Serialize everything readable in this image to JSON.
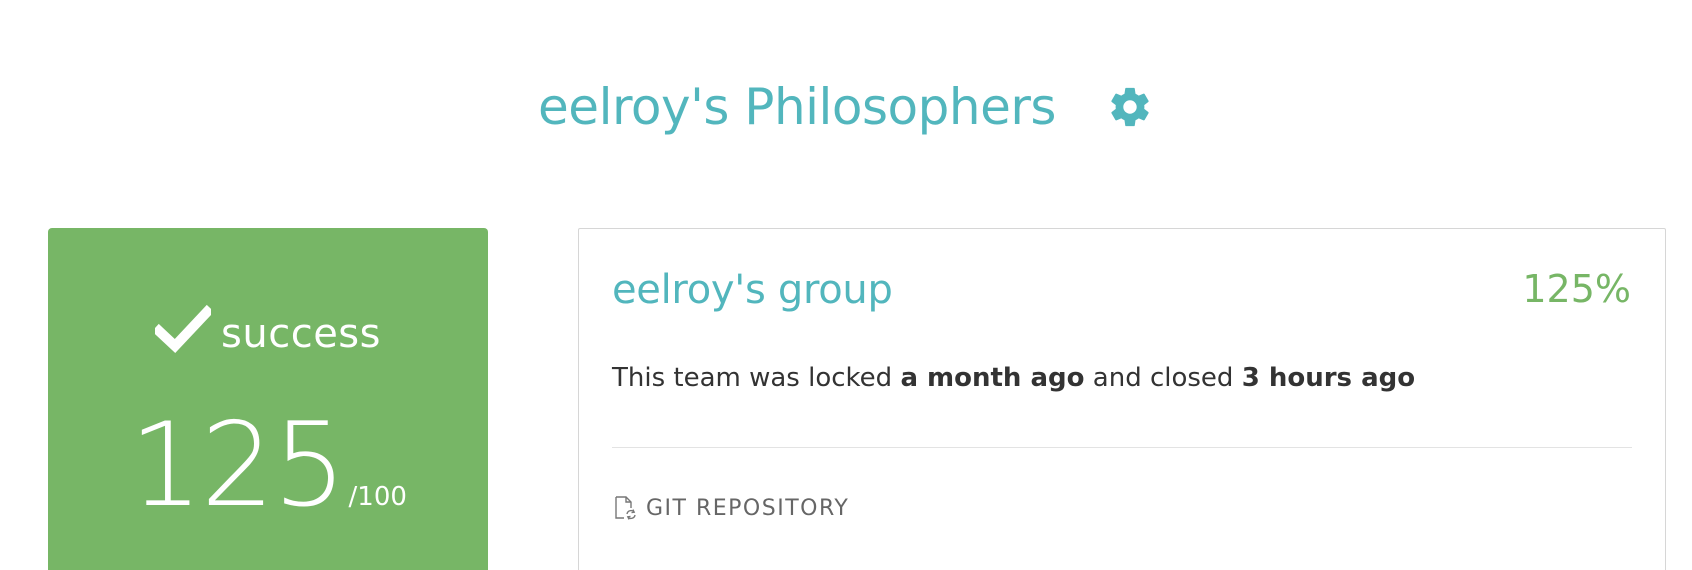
{
  "header": {
    "team_title": "eelroy's Philosophers",
    "settings_icon": "gear-icon"
  },
  "status": {
    "icon": "check-icon",
    "label": "success",
    "score": "125",
    "score_max": "/100",
    "color": "#77b666"
  },
  "group": {
    "name": "eelroy's group",
    "percent": "125%",
    "lock_prefix": "This team was locked ",
    "locked_when": "a month ago",
    "lock_middle": " and closed ",
    "closed_when": "3 hours ago",
    "repo_icon": "file-refresh-icon",
    "repo_label": "GIT REPOSITORY"
  },
  "colors": {
    "accent": "#52b6bd",
    "success": "#77b666",
    "text": "#333333"
  }
}
